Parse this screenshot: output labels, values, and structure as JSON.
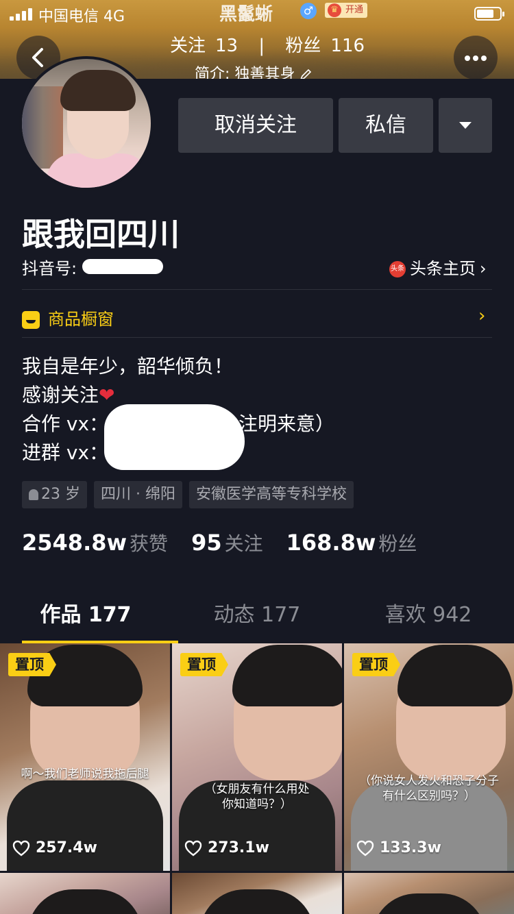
{
  "status_bar": {
    "carrier": "中国电信",
    "network": "4G",
    "title": "黑鬣蜥",
    "vip_label": "开通"
  },
  "header": {
    "following_label": "关注",
    "following_count": "13",
    "separator": "|",
    "followers_label": "粉丝",
    "followers_count": "116",
    "intro": "简介: 独善其身"
  },
  "actions": {
    "unfollow_label": "取消关注",
    "message_label": "私信"
  },
  "profile": {
    "name": "跟我回四川",
    "douyin_id_label": "抖音号:",
    "toutiao_label": "头条主页",
    "toutiao_badge": "头条",
    "shop_label": "商品橱窗",
    "bio_line1": "我自是年少，韶华倾负！",
    "bio_line2": "感谢关注",
    "bio_heart": "❤",
    "bio_line3_prefix": "合作 vx：",
    "bio_line3_suffix": "注明来意）",
    "bio_line4": "进群 vx：",
    "tags": [
      "23 岁",
      "四川 · 绵阳",
      "安徽医学高等专科学校"
    ]
  },
  "stats": [
    {
      "value": "2548.8w",
      "label": "获赞"
    },
    {
      "value": "95",
      "label": "关注"
    },
    {
      "value": "168.8w",
      "label": "粉丝"
    }
  ],
  "tabs": [
    {
      "label": "作品 177",
      "active": true
    },
    {
      "label": "动态 177",
      "active": false
    },
    {
      "label": "喜欢 942",
      "active": false
    }
  ],
  "videos": [
    {
      "pinned_label": "置顶",
      "caption": "啊～我们老师说我拖后腿",
      "likes": "257.4w"
    },
    {
      "pinned_label": "置顶",
      "caption": "（女朋友有什么用处\n你知道吗？）",
      "likes": "273.1w"
    },
    {
      "pinned_label": "置顶",
      "caption": "（你说女人发火和恐子分子\n有什么区别吗？）",
      "likes": "133.3w"
    }
  ],
  "colors": {
    "background": "#161823",
    "accent_yellow": "#face15",
    "button_gray": "#393b44",
    "muted_text": "#8b8d94"
  }
}
